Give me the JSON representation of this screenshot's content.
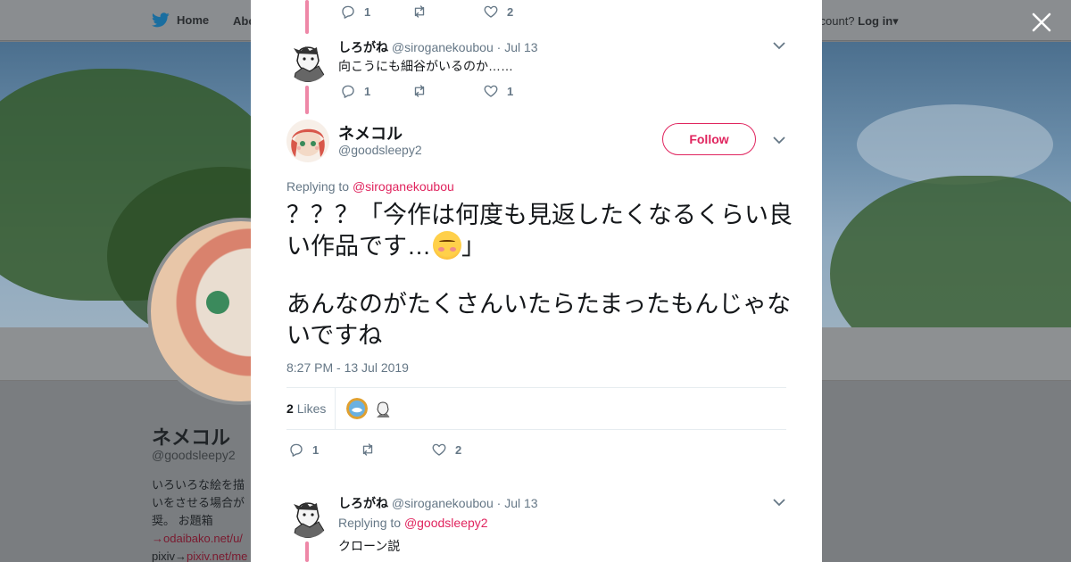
{
  "colors": {
    "accent": "#e0245e",
    "twitter_blue": "#1da1f2",
    "muted": "#657786",
    "text": "#14171a"
  },
  "background_page": {
    "nav": {
      "home_label": "Home",
      "about_label": "Abo",
      "account_prompt": "ccount?",
      "login_label": "Log in"
    },
    "profile": {
      "name": "ネメコル",
      "handle": "@goodsleepy2",
      "bio_lines": [
        "いろいろな絵を描",
        "いをさせる場合が",
        "奨。 お題箱"
      ],
      "bio_link1": "→odaibako.net/u/",
      "bio_pixiv_label": "pixiv→",
      "bio_link2": "pixiv.net/me"
    }
  },
  "modal": {
    "top_actions": {
      "reply_count": "1",
      "retweet_count": "",
      "like_count": "2"
    },
    "prev_tweet": {
      "name": "しろがね",
      "handle": "@siroganekoubou",
      "date": "· Jul 13",
      "text": "向こうにも細谷がいるのか……",
      "reply_count": "1",
      "like_count": "1"
    },
    "focus_tweet": {
      "name": "ネメコル",
      "handle": "@goodsleepy2",
      "follow_label": "Follow",
      "replying_prefix": "Replying to",
      "replying_to": "@siroganekoubou",
      "text_line1_a": "？？？「今作は何度も見返したくなるくらい良い作品です…",
      "text_line1_b": "」",
      "text_line2": "あんなのがたくさんいたらたまったもんじゃないですね",
      "timestamp": "8:27 PM - 13 Jul 2019",
      "likes_count": "2",
      "likes_label": "Likes",
      "reply_count": "1",
      "like_count": "2"
    },
    "next_tweet": {
      "name": "しろがね",
      "handle": "@siroganekoubou",
      "date": "· Jul 13",
      "replying_prefix": "Replying to",
      "replying_to": "@goodsleepy2",
      "text": "クローン説"
    }
  }
}
